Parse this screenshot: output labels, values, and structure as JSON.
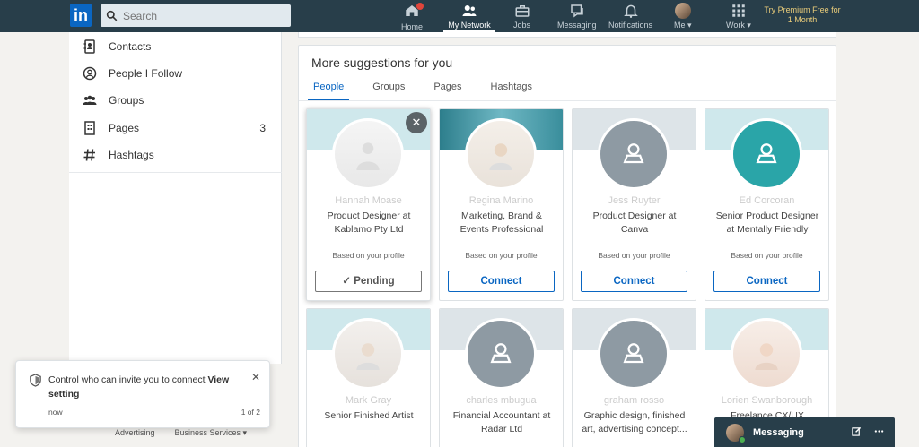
{
  "nav": {
    "search_placeholder": "Search",
    "items": [
      {
        "label": "Home"
      },
      {
        "label": "My Network"
      },
      {
        "label": "Jobs"
      },
      {
        "label": "Messaging"
      },
      {
        "label": "Notifications"
      },
      {
        "label": "Me ▾"
      },
      {
        "label": "Work ▾"
      }
    ],
    "premium": "Try Premium Free for 1 Month"
  },
  "left_panel": {
    "items": [
      {
        "label": "Contacts",
        "count": ""
      },
      {
        "label": "People I Follow",
        "count": ""
      },
      {
        "label": "Groups",
        "count": ""
      },
      {
        "label": "Pages",
        "count": "3"
      },
      {
        "label": "Hashtags",
        "count": ""
      }
    ],
    "footer": {
      "advertising": "Advertising",
      "business": "Business Services ▾"
    }
  },
  "suggestions": {
    "title": "More suggestions for you",
    "tabs": [
      "People",
      "Groups",
      "Pages",
      "Hashtags"
    ],
    "cards": [
      {
        "name": "Hannah Moase",
        "headline": "Product Designer at Kablamo Pty Ltd",
        "reason": "Based on your profile",
        "button": "Pending",
        "pending_icon": "✓"
      },
      {
        "name": "Regina Marino",
        "headline": "Marketing, Brand & Events Professional",
        "reason": "Based on your profile",
        "button": "Connect"
      },
      {
        "name": "Jess Ruyter",
        "headline": "Product Designer at Canva",
        "reason": "Based on your profile",
        "button": "Connect"
      },
      {
        "name": "Ed Corcoran",
        "headline": "Senior Product Designer at Mentally Friendly",
        "reason": "Based on your profile",
        "button": "Connect"
      },
      {
        "name": "Mark Gray",
        "headline": "Senior Finished Artist"
      },
      {
        "name": "charles mbugua",
        "headline": "Financial Accountant at Radar Ltd"
      },
      {
        "name": "graham rosso",
        "headline": "Graphic design, finished art, advertising concept..."
      },
      {
        "name": "Lorien Swanborough",
        "headline": "Freelance CX/UX"
      }
    ]
  },
  "toast": {
    "message": "Control who can invite you to connect",
    "link": "View setting",
    "time": "now",
    "page": "1 of 2",
    "close": "✕"
  },
  "messaging": {
    "label": "Messaging"
  },
  "colors": {
    "nav_bg": "#283e4a",
    "accent": "#0a66c2",
    "premium": "#ebcd7a",
    "teal_avatar": "#2aa5a8"
  }
}
